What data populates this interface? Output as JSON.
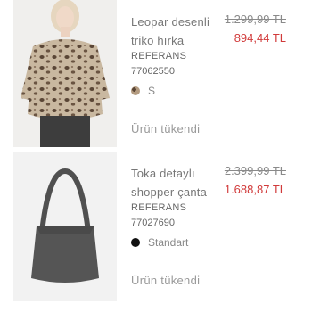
{
  "products": [
    {
      "name": "Leopar desenli triko hırka",
      "old_price": "1.299,99 TL",
      "new_price": "894,44 TL",
      "ref_label": "REFERANS",
      "ref_value": "77062550",
      "variant": "S",
      "variant_swatch": "leopard-swatch",
      "status": "Ürün tükendi"
    },
    {
      "name": "Toka detaylı shopper çanta",
      "old_price": "2.399,99 TL",
      "new_price": "1.688,87 TL",
      "ref_label": "REFERANS",
      "ref_value": "77027690",
      "variant": "Standart",
      "variant_swatch": "black-swatch",
      "status": "Ürün tükendi"
    }
  ],
  "colors": {
    "sale_price": "#d13a3a",
    "text": "#777777",
    "swatch_black": "#111111"
  }
}
